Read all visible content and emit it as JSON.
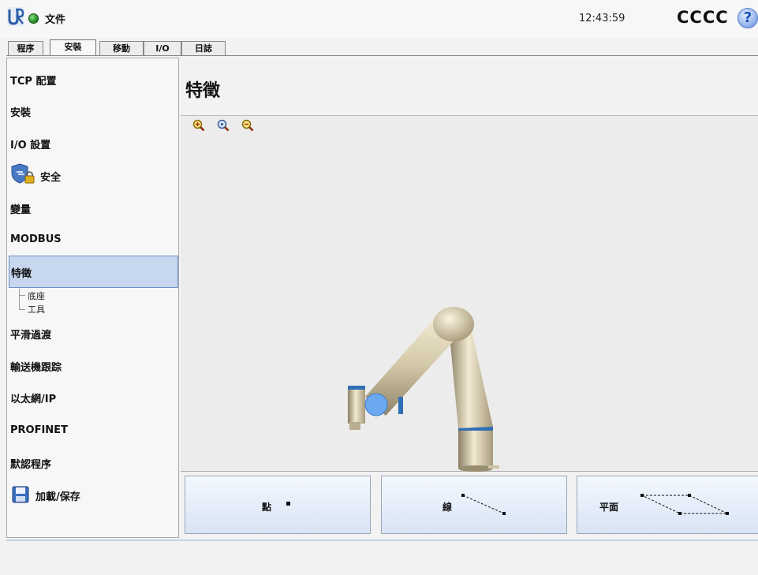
{
  "header": {
    "file_name": "文件",
    "time": "12:43:59",
    "robot_name": "CCCC",
    "help_glyph": "?"
  },
  "tabs": [
    {
      "label": "程序"
    },
    {
      "label": "安裝",
      "active": true
    },
    {
      "label": "移動"
    },
    {
      "label": "I/O"
    },
    {
      "label": "日誌"
    }
  ],
  "sidebar": {
    "items": [
      {
        "label": "TCP 配置"
      },
      {
        "label": "安裝"
      },
      {
        "label": "I/O 設置"
      },
      {
        "label": "安全",
        "icon": "safety-shield-lock-icon"
      },
      {
        "label": "變量"
      },
      {
        "label": "MODBUS"
      },
      {
        "label": "特徵",
        "selected": true
      },
      {
        "label": "平滑過渡"
      },
      {
        "label": "輸送機跟踪"
      },
      {
        "label": "以太網/IP"
      },
      {
        "label": "PROFINET"
      },
      {
        "label": "默認程序"
      },
      {
        "label": "加載/保存",
        "icon": "save-disk-icon"
      }
    ],
    "feature_children": [
      {
        "label": "底座"
      },
      {
        "label": "工具"
      }
    ]
  },
  "main": {
    "title": "特徵",
    "zoom_icons": [
      "zoom-in-icon",
      "zoom-reset-icon",
      "zoom-out-icon"
    ],
    "feature_buttons": [
      {
        "label": "點",
        "icon": "point-icon"
      },
      {
        "label": "線",
        "icon": "line-icon"
      },
      {
        "label": "平面",
        "icon": "plane-icon"
      }
    ]
  },
  "colors": {
    "selection": "#c7d7ee",
    "status_green": "#1f8f1f",
    "robot_body": "#d8cfb4",
    "joint_blue": "#2f6fb5"
  }
}
